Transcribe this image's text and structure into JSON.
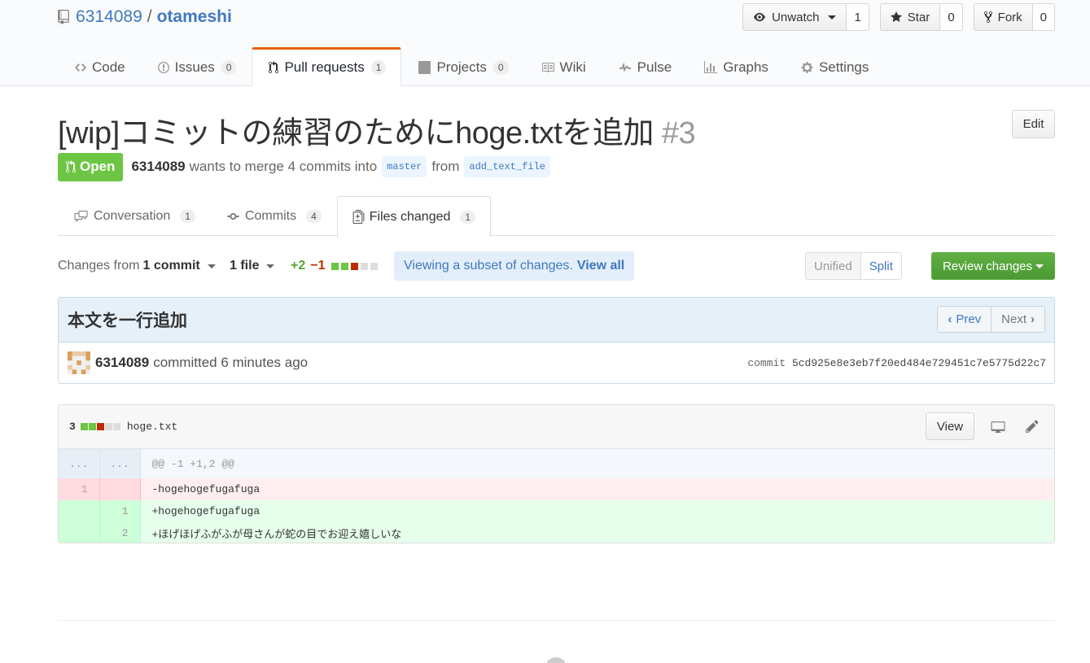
{
  "repo": {
    "owner": "6314089",
    "separator": "/",
    "name": "otameshi"
  },
  "actions": {
    "watch": {
      "label": "Unwatch",
      "count": "1"
    },
    "star": {
      "label": "Star",
      "count": "0"
    },
    "fork": {
      "label": "Fork",
      "count": "0"
    }
  },
  "reponav": [
    {
      "label": "Code",
      "icon": "code-icon"
    },
    {
      "label": "Issues",
      "count": "0",
      "icon": "issue-icon"
    },
    {
      "label": "Pull requests",
      "count": "1",
      "icon": "pull-request-icon",
      "selected": true
    },
    {
      "label": "Projects",
      "count": "0",
      "icon": "project-icon"
    },
    {
      "label": "Wiki",
      "icon": "book-icon"
    },
    {
      "label": "Pulse",
      "icon": "pulse-icon"
    },
    {
      "label": "Graphs",
      "icon": "graph-icon"
    },
    {
      "label": "Settings",
      "icon": "gear-icon"
    }
  ],
  "pr": {
    "title": "[wip]コミットの練習のためにhoge.txtを追加",
    "number": "#3",
    "edit_label": "Edit",
    "state": "Open",
    "author": "6314089",
    "merge_text": "wants to merge 4 commits into",
    "base": "master",
    "from": "from",
    "head": "add_text_file"
  },
  "tabs": [
    {
      "label": "Conversation",
      "count": "1",
      "icon": "comment-discussion-icon"
    },
    {
      "label": "Commits",
      "count": "4",
      "icon": "git-commit-icon"
    },
    {
      "label": "Files changed",
      "count": "1",
      "icon": "diff-icon",
      "selected": true
    }
  ],
  "toolbar": {
    "changes_prefix": "Changes from",
    "changes_value": "1 commit",
    "files_value": "1 file",
    "additions": "+2",
    "deletions": "−1",
    "subset_note": "Viewing a subset of changes.",
    "view_all": "View all",
    "unified": "Unified",
    "split": "Split",
    "review": "Review changes"
  },
  "commit": {
    "title": "本文を一行追加",
    "prev": "Prev",
    "next": "Next",
    "author": "6314089",
    "committed_text": "committed 6 minutes ago",
    "sha_label": "commit",
    "sha": "5cd925e8e3eb7f20ed484e729451c7e5775d22c7"
  },
  "file": {
    "changes": "3",
    "name": "hoge.txt",
    "view_label": "View",
    "hunk": "@@ -1 +1,2 @@",
    "ellipsis": "...",
    "lines": [
      {
        "type": "del",
        "old": "1",
        "new": "",
        "text": "-hogehogefugafuga"
      },
      {
        "type": "add",
        "old": "",
        "new": "1",
        "text": "+hogehogefugafuga"
      },
      {
        "type": "add",
        "old": "",
        "new": "2",
        "text": "+ほげほげふがふが母さんが蛇の目でお迎え嬉しいな"
      }
    ]
  },
  "colors": {
    "link": "#4078c0",
    "open": "#6cc644",
    "deletion": "#bd2c00",
    "accent": "#e36209"
  }
}
